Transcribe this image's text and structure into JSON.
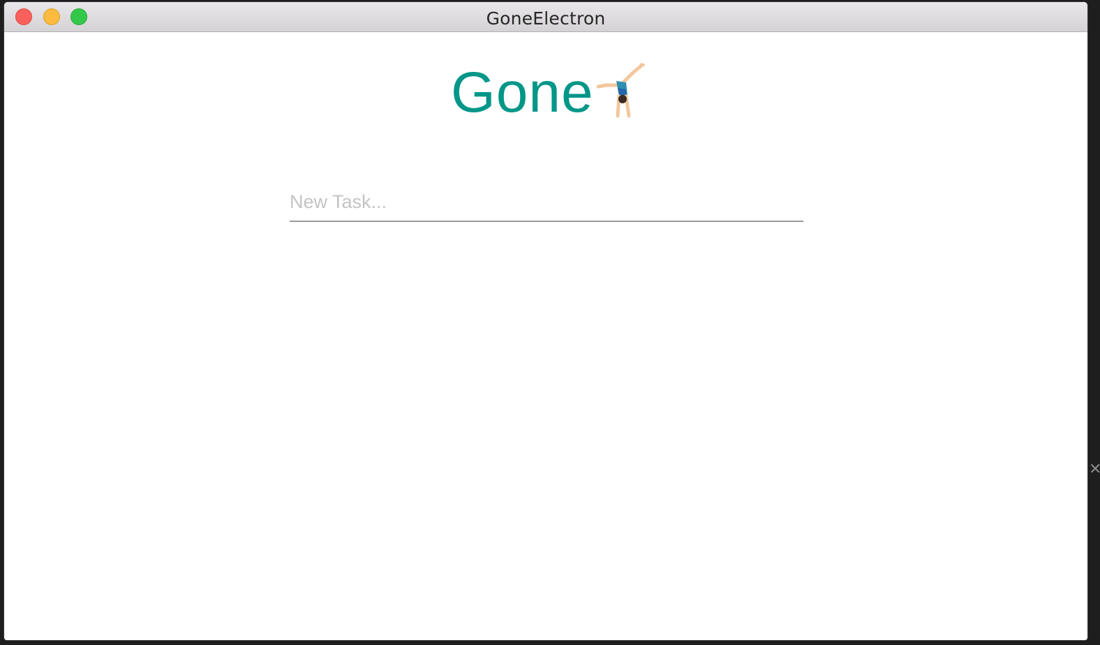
{
  "window": {
    "title": "GoneElectron"
  },
  "app": {
    "logo_text": "Gone",
    "logo_icon": "person-doing-cartwheel-emoji",
    "brand_color": "#009688"
  },
  "task_input": {
    "placeholder": "New Task...",
    "value": ""
  },
  "background_edge": {
    "close_glyph": "✕"
  }
}
